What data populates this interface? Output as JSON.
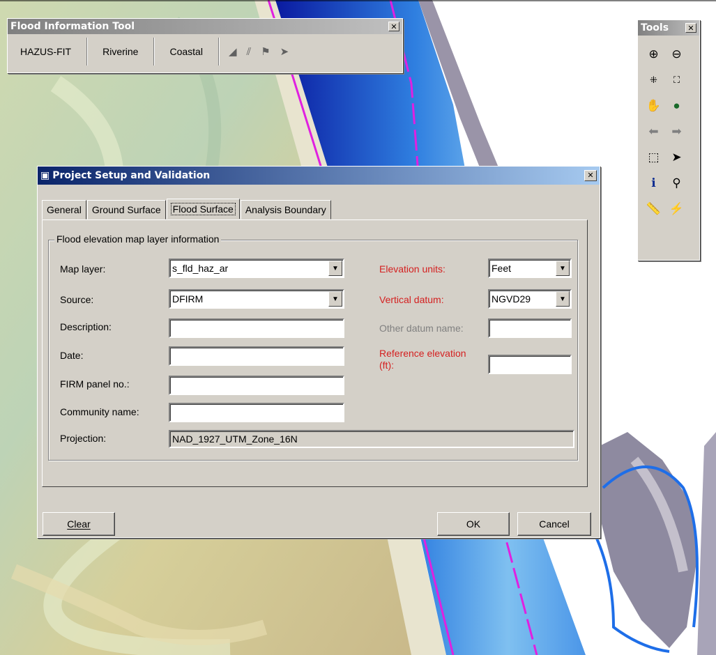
{
  "fit_window": {
    "title": "Flood Information Tool",
    "buttons": [
      "HAZUS-FIT",
      "Riverine",
      "Coastal"
    ],
    "icons": [
      "flag-icon",
      "stripe-tool-icon",
      "flag-arrow-icon",
      "pointer-icon"
    ]
  },
  "tools_window": {
    "title": "Tools",
    "icons": [
      "zoom-in-icon",
      "zoom-out-icon",
      "zoom-in-fixed-icon",
      "zoom-out-fixed-icon",
      "pan-icon",
      "full-extent-icon",
      "back-icon",
      "forward-icon",
      "select-features-icon",
      "select-elements-icon",
      "identify-icon",
      "find-icon",
      "measure-icon",
      "hyperlink-icon"
    ]
  },
  "dialog": {
    "title": "Project Setup and Validation",
    "tabs": [
      "General",
      "Ground Surface",
      "Flood Surface",
      "Analysis Boundary"
    ],
    "group_title": "Flood elevation map layer information",
    "labels": {
      "map_layer": "Map layer:",
      "source": "Source:",
      "description": "Description:",
      "date": "Date:",
      "firm_panel": "FIRM panel no.:",
      "community": "Community name:",
      "projection": "Projection:",
      "elevation_units": "Elevation units:",
      "vertical_datum": "Vertical datum:",
      "other_datum": "Other datum name:",
      "reference_elevation": "Reference elevation (ft):"
    },
    "values": {
      "map_layer": "s_fld_haz_ar",
      "source": "DFIRM",
      "description": "",
      "date": "",
      "firm_panel": "",
      "community": "",
      "projection": "NAD_1927_UTM_Zone_16N",
      "elevation_units": "Feet",
      "vertical_datum": "NGVD29",
      "other_datum": "",
      "reference_elevation": ""
    },
    "buttons": {
      "clear": "Clear",
      "ok": "OK",
      "cancel": "Cancel"
    }
  },
  "colors": {
    "title_active": "#0a246a",
    "red_label": "#d42020",
    "water_blue": "#1e3cc8",
    "flood_line": "#e020e0"
  }
}
